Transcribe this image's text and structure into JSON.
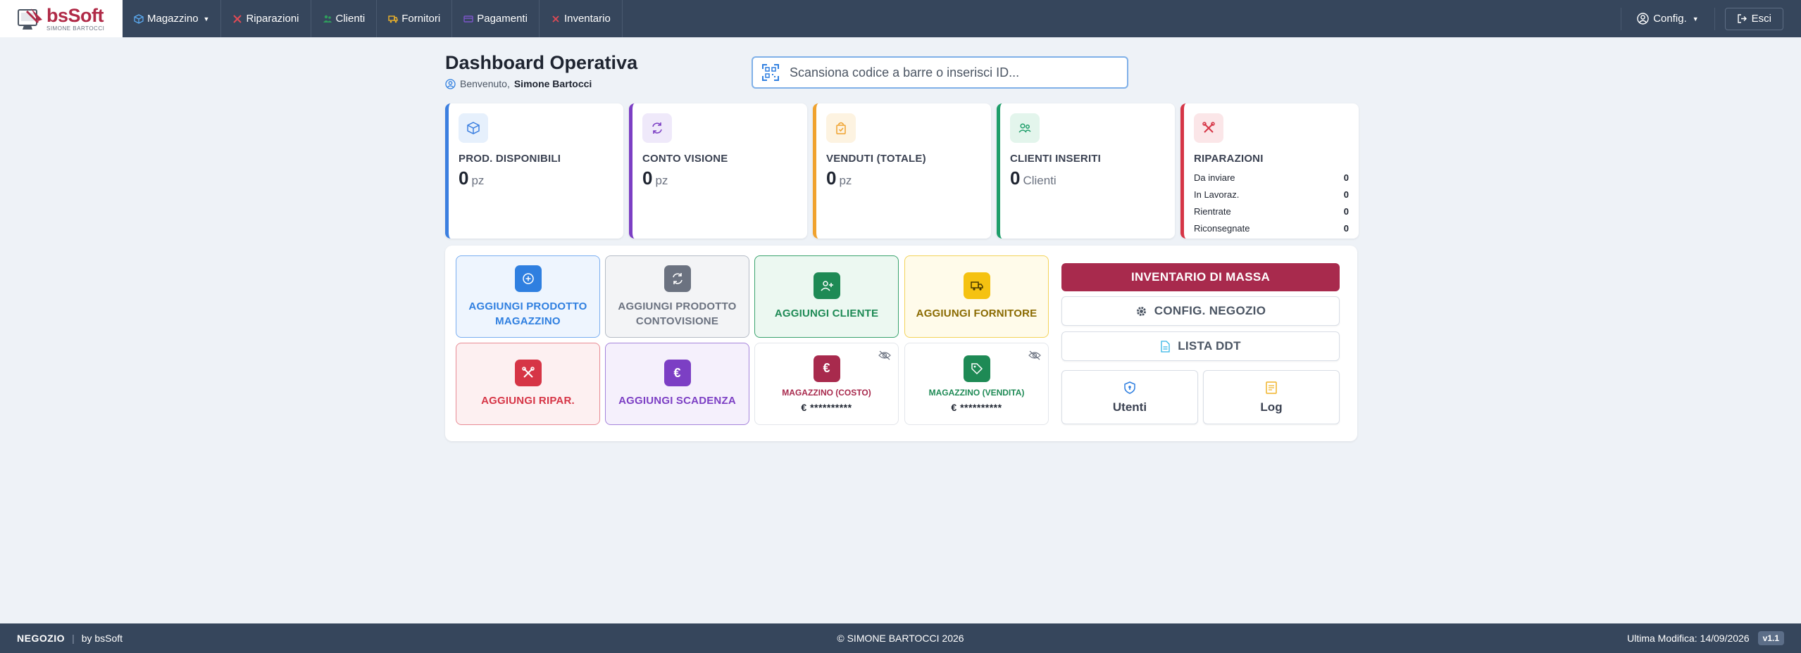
{
  "brand": {
    "name_part1": "bs",
    "name_part2": "Soft",
    "subtitle": "SIMONE BARTOCCI",
    "accent": "#b02a47"
  },
  "nav": {
    "items": [
      {
        "label": "Magazzino",
        "icon": "box-icon",
        "color": "#5aa9f0",
        "dropdown": true
      },
      {
        "label": "Riparazioni",
        "icon": "tools-icon",
        "color": "#e04a55",
        "dropdown": false
      },
      {
        "label": "Clienti",
        "icon": "people-icon",
        "color": "#2f9e5c",
        "dropdown": false
      },
      {
        "label": "Fornitori",
        "icon": "truck-icon",
        "color": "#f0b429",
        "dropdown": false
      },
      {
        "label": "Pagamenti",
        "icon": "card-icon",
        "color": "#7c56c9",
        "dropdown": false
      },
      {
        "label": "Inventario",
        "icon": "x-icon",
        "color": "#e04a55",
        "dropdown": false
      }
    ],
    "config_label": "Config.",
    "logout_label": "Esci"
  },
  "header": {
    "title": "Dashboard Operativa",
    "welcome_prefix": "Benvenuto,",
    "user_name": "Simone Bartocci"
  },
  "search": {
    "placeholder": "Scansiona codice a barre o inserisci ID..."
  },
  "stats": {
    "products": {
      "label": "PROD. DISPONIBILI",
      "value": "0",
      "unit": "pz",
      "color": "#3b7fe0"
    },
    "conto": {
      "label": "CONTO VISIONE",
      "value": "0",
      "unit": "pz",
      "color": "#7c3fc4"
    },
    "sold": {
      "label": "VENDUTI (TOTALE)",
      "value": "0",
      "unit": "pz",
      "color": "#f0a22e"
    },
    "clients": {
      "label": "CLIENTI INSERITI",
      "value": "0",
      "unit": "Clienti",
      "color": "#1e9e6a"
    },
    "repairs": {
      "label": "RIPARAZIONI",
      "color": "#d63546",
      "rows": [
        {
          "label": "Da inviare",
          "value": "0"
        },
        {
          "label": "In Lavoraz.",
          "value": "0"
        },
        {
          "label": "Rientrate",
          "value": "0"
        },
        {
          "label": "Riconsegnate",
          "value": "0"
        }
      ]
    }
  },
  "actions": {
    "add_product": {
      "line1": "AGGIUNGI PRODOTTO",
      "line2": "MAGAZZINO"
    },
    "add_conto": {
      "line1": "AGGIUNGI PRODOTTO",
      "line2": "CONTOVISIONE"
    },
    "add_client": {
      "label": "AGGIUNGI CLIENTE"
    },
    "add_supplier": {
      "label": "AGGIUNGI FORNITORE"
    },
    "add_repair": {
      "label": "AGGIUNGI RIPAR."
    },
    "add_deadline": {
      "label": "AGGIUNGI SCADENZA"
    },
    "stock_cost": {
      "label": "MAGAZZINO (COSTO)",
      "value": "€ **********"
    },
    "stock_sale": {
      "label": "MAGAZZINO (VENDITA)",
      "value": "€ **********"
    }
  },
  "side": {
    "inventory_label": "INVENTARIO DI MASSA",
    "config_shop_label": "CONFIG. NEGOZIO",
    "ddt_label": "LISTA DDT",
    "users_label": "Utenti",
    "log_label": "Log"
  },
  "footer": {
    "shop": "NEGOZIO",
    "sep": "|",
    "by": "by bsSoft",
    "copyright": "© SIMONE BARTOCCI 2026",
    "last_modified": "Ultima Modifica: 14/09/2026",
    "version": "v1.1"
  }
}
